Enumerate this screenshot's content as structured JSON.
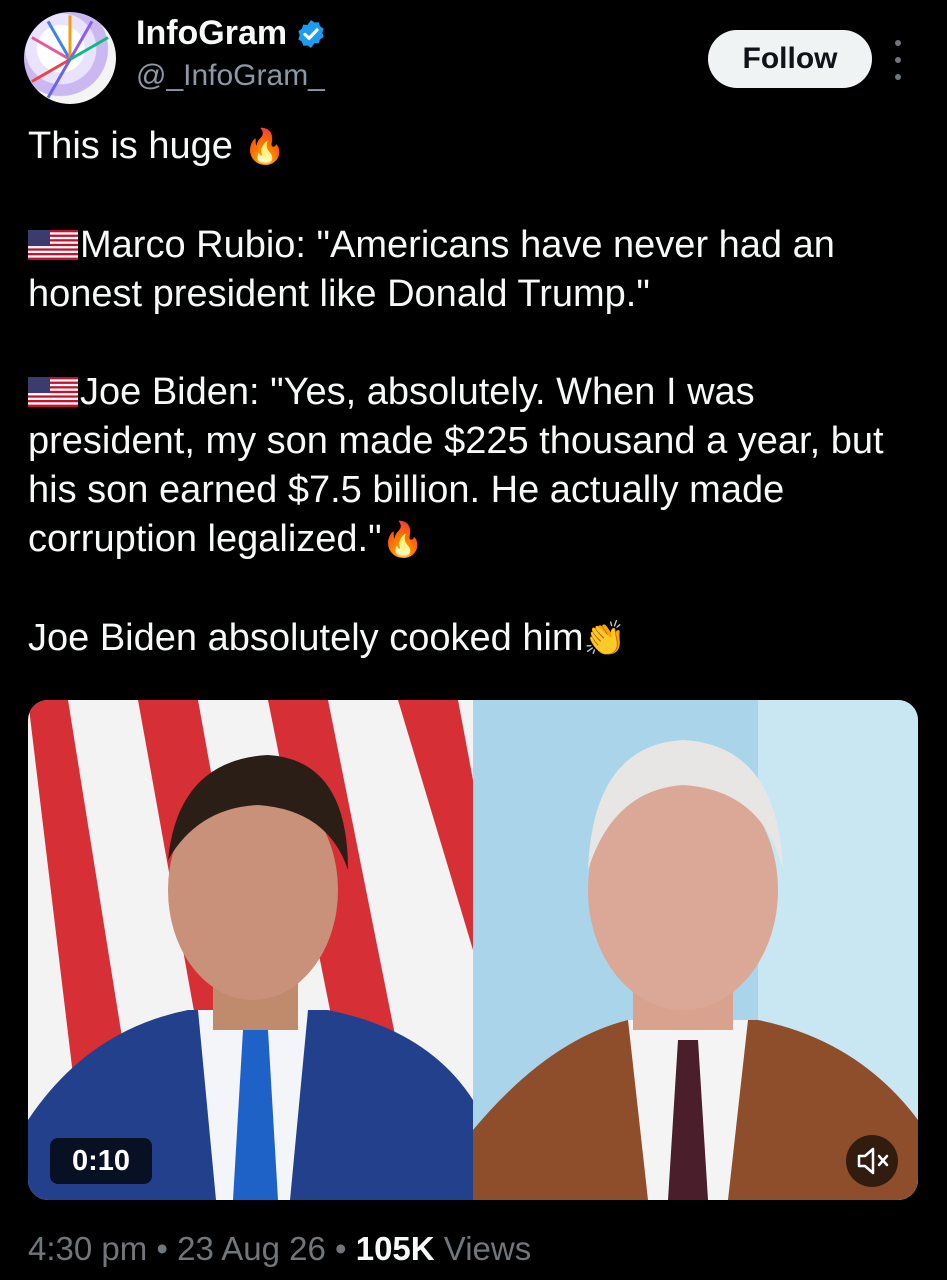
{
  "account": {
    "name": "InfoGram",
    "handle": "@_InfoGram_",
    "follow_label": "Follow"
  },
  "post": {
    "line1": "This is huge",
    "line1_emoji": "🔥",
    "para2": "Marco Rubio: \"Americans have never had an honest president like Donald Trump.\"",
    "para3": "Joe Biden: \"Yes, absolutely. When I was president, my son made $225 thousand a year, but his son earned $7.5 billion. He actually made corruption legalized.\"",
    "para3_emoji": "🔥",
    "para4": "Joe Biden absolutely cooked him",
    "para4_emoji": "👏"
  },
  "media": {
    "duration": "0:10",
    "mute_icon": "speaker-muted-icon"
  },
  "meta": {
    "time": "4:30 pm",
    "sep": "•",
    "date": "23 Aug 26",
    "views_count": "105K",
    "views_label": "Views"
  },
  "colors": {
    "background": "#000000",
    "verified": "#1d9bf0",
    "follow_bg": "#eff3f4",
    "secondary_text": "#71767b"
  }
}
